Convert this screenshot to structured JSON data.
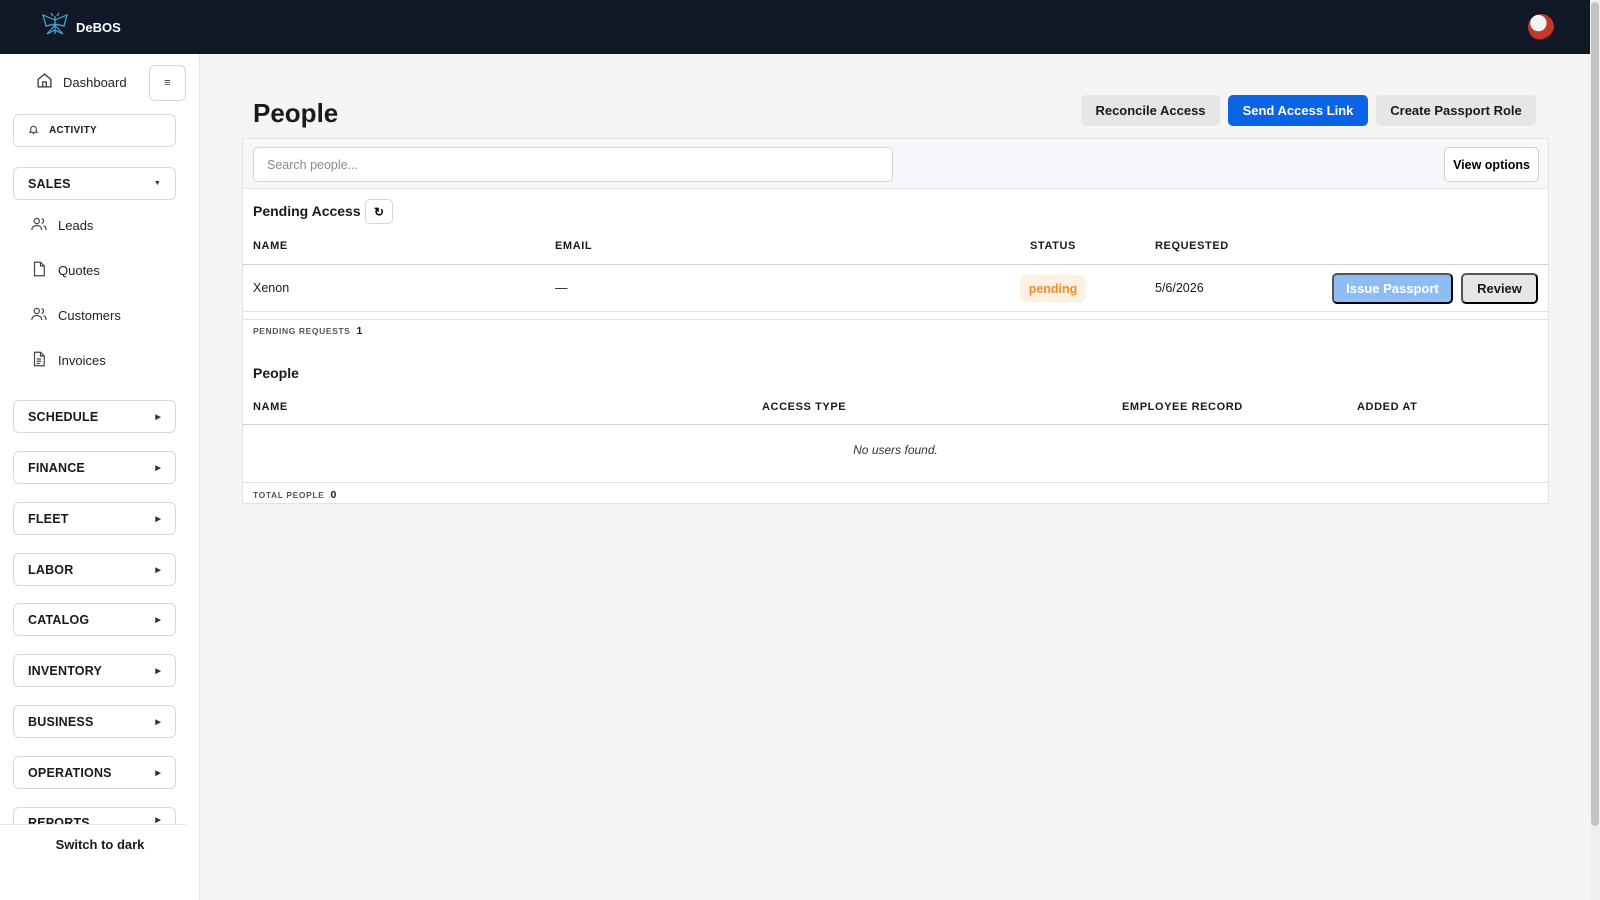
{
  "app": {
    "brand": "DeBOS"
  },
  "sidebar": {
    "dashboard": "Dashboard",
    "collapse_icon": "≡",
    "activity": "ACTIVITY",
    "sales": {
      "label": "SALES",
      "items": [
        "Leads",
        "Quotes",
        "Customers",
        "Invoices"
      ]
    },
    "sections": [
      "SCHEDULE",
      "FINANCE",
      "FLEET",
      "LABOR",
      "CATALOG",
      "INVENTORY",
      "BUSINESS",
      "OPERATIONS",
      "REPORTS"
    ],
    "switch_theme": "Switch to dark"
  },
  "header": {
    "title": "People",
    "buttons": {
      "reconcile": "Reconcile Access",
      "send_link": "Send Access Link",
      "create_role": "Create Passport Role"
    }
  },
  "search": {
    "placeholder": "Search people...",
    "view_options": "View options"
  },
  "pending": {
    "title": "Pending Access",
    "refresh_icon": "↻",
    "columns": {
      "name": "NAME",
      "email": "EMAIL",
      "status": "STATUS",
      "requested": "REQUESTED"
    },
    "rows": [
      {
        "name": "Xenon",
        "email": "—",
        "status": "pending",
        "requested": "5/6/2026",
        "issue": "Issue Passport",
        "review": "Review"
      }
    ],
    "footer_label": "PENDING REQUESTS",
    "footer_count": "1"
  },
  "people": {
    "title": "People",
    "columns": {
      "name": "NAME",
      "access_type": "ACCESS TYPE",
      "employee_record": "EMPLOYEE RECORD",
      "added_at": "ADDED AT"
    },
    "empty": "No users found.",
    "footer_label": "TOTAL PEOPLE",
    "footer_count": "0"
  },
  "colors": {
    "topbar": "#111827",
    "primary": "#0b63e5",
    "primary_disabled": "#8ebcf4",
    "pending_text": "#f28c28",
    "pending_bg": "#fdf1e3"
  }
}
